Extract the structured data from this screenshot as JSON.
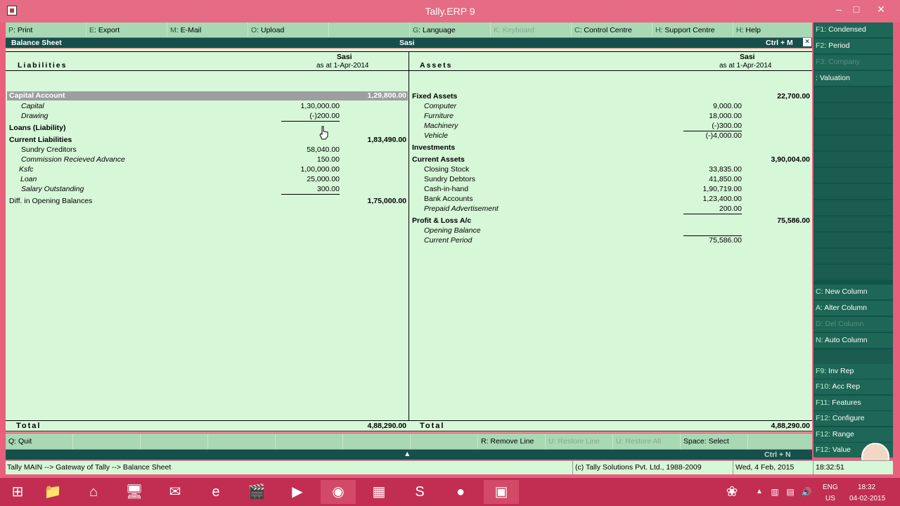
{
  "window": {
    "title": "Tally.ERP 9"
  },
  "toolbar": [
    {
      "key": "P",
      "label": ": Print"
    },
    {
      "key": "E",
      "label": ": Export"
    },
    {
      "key": "M",
      "label": ": E-Mail"
    },
    {
      "key": "O",
      "label": ": Upload"
    },
    {
      "key": "",
      "label": ""
    },
    {
      "key": "G",
      "label": ": Language"
    },
    {
      "key": "K",
      "label": ": Keyboard",
      "disabled": true
    },
    {
      "key": "C",
      "label": ": Control Centre"
    },
    {
      "key": "H",
      "label": ": Support Centre"
    },
    {
      "key": "H",
      "label": ": Help"
    }
  ],
  "header": {
    "left": "Balance Sheet",
    "center": "Sasi",
    "right": "Ctrl + M",
    "close": "×"
  },
  "columns": {
    "liabilities_title": "Liabilities",
    "assets_title": "Assets",
    "company": "Sasi",
    "as_at": "as at 1-Apr-2014"
  },
  "liabilities": {
    "capital_account": {
      "label": "Capital Account",
      "amount": "1,29,800.00"
    },
    "capital": {
      "label": "Capital",
      "amount": "1,30,000.00"
    },
    "drawing": {
      "label": "Drawing",
      "amount": "(-)200.00"
    },
    "loans": {
      "label": "Loans (Liability)"
    },
    "current_liabilities": {
      "label": "Current Liabilities",
      "amount": "1,83,490.00"
    },
    "sundry_creditors": {
      "label": "Sundry Creditors",
      "amount": "58,040.00"
    },
    "commission": {
      "label": "Commission Recieved Advance",
      "amount": "150.00"
    },
    "ksfc": {
      "label": "Ksfc",
      "amount": "1,00,000.00"
    },
    "loan": {
      "label": "Loan",
      "amount": "25,000.00"
    },
    "salary": {
      "label": "Salary Outstanding",
      "amount": "300.00"
    },
    "diff": {
      "label": "Diff. in Opening Balances",
      "amount": "1,75,000.00"
    }
  },
  "assets": {
    "fixed_assets": {
      "label": "Fixed Assets",
      "amount": "22,700.00"
    },
    "computer": {
      "label": "Computer",
      "amount": "9,000.00"
    },
    "furniture": {
      "label": "Furniture",
      "amount": "18,000.00"
    },
    "machinery": {
      "label": "Machinery",
      "amount": "(-)300.00"
    },
    "vehicle": {
      "label": "Vehicle",
      "amount": "(-)4,000.00"
    },
    "investments": {
      "label": "Investments"
    },
    "current_assets": {
      "label": "Current Assets",
      "amount": "3,90,004.00"
    },
    "closing_stock": {
      "label": "Closing Stock",
      "amount": "33,835.00"
    },
    "sundry_debtors": {
      "label": "Sundry Debtors",
      "amount": "41,850.00"
    },
    "cash": {
      "label": "Cash-in-hand",
      "amount": "1,90,719.00"
    },
    "bank": {
      "label": "Bank Accounts",
      "amount": "1,23,400.00"
    },
    "prepaid": {
      "label": "Prepaid Advertisement",
      "amount": "200.00"
    },
    "pl": {
      "label": "Profit & Loss A/c",
      "amount": "75,586.00"
    },
    "opening": {
      "label": "Opening Balance"
    },
    "current_period": {
      "label": "Current Period",
      "amount": "75,586.00"
    }
  },
  "totals": {
    "label": "Total",
    "liabilities": "4,88,290.00",
    "assets": "4,88,290.00"
  },
  "sidebar": {
    "f1": {
      "key": "F1",
      "label": ": Condensed"
    },
    "f2": {
      "key": "F2",
      "label": ": Period"
    },
    "f3": {
      "key": "F3",
      "label": ": Company"
    },
    "f4": {
      "key": "",
      "label": ": Valuation"
    },
    "c": {
      "key": "C",
      "label": ": New Column"
    },
    "a": {
      "key": "A",
      "label": ": Alter Column"
    },
    "d": {
      "key": "D",
      "label": ": Del Column"
    },
    "n": {
      "key": "N",
      "label": ": Auto Column"
    },
    "f9": {
      "key": "F9",
      "label": ": Inv Rep"
    },
    "f10": {
      "key": "F10",
      "label": ": Acc Rep"
    },
    "f11": {
      "key": "F11",
      "label": ": Features"
    },
    "f12": {
      "key": "F12",
      "label": ": Configure"
    },
    "f12b": {
      "key": "F12",
      "label": ": Range"
    },
    "f12c": {
      "key": "F12",
      "label": ": Value"
    }
  },
  "bottombar": {
    "quit": {
      "key": "Q",
      "label": ": Quit"
    },
    "remove": {
      "key": "R",
      "label": ": Remove Line"
    },
    "restore": {
      "key": "U",
      "label": ": Restore Line"
    },
    "restore_all": {
      "key": "U",
      "label": ": Restore All"
    },
    "space": {
      "key": "Space",
      "label": ": Select"
    },
    "ctrl_n": "Ctrl + N"
  },
  "status": {
    "breadcrumb": "Tally MAIN --> Gateway of Tally --> Balance Sheet",
    "copyright": "(c) Tally Solutions Pvt. Ltd., 1988-2009",
    "date": "Wed, 4 Feb, 2015",
    "time": "18:32:51"
  },
  "taskbar": {
    "lang": "ENG",
    "region": "US",
    "clock": "18:32",
    "date": "04-02-2015"
  }
}
